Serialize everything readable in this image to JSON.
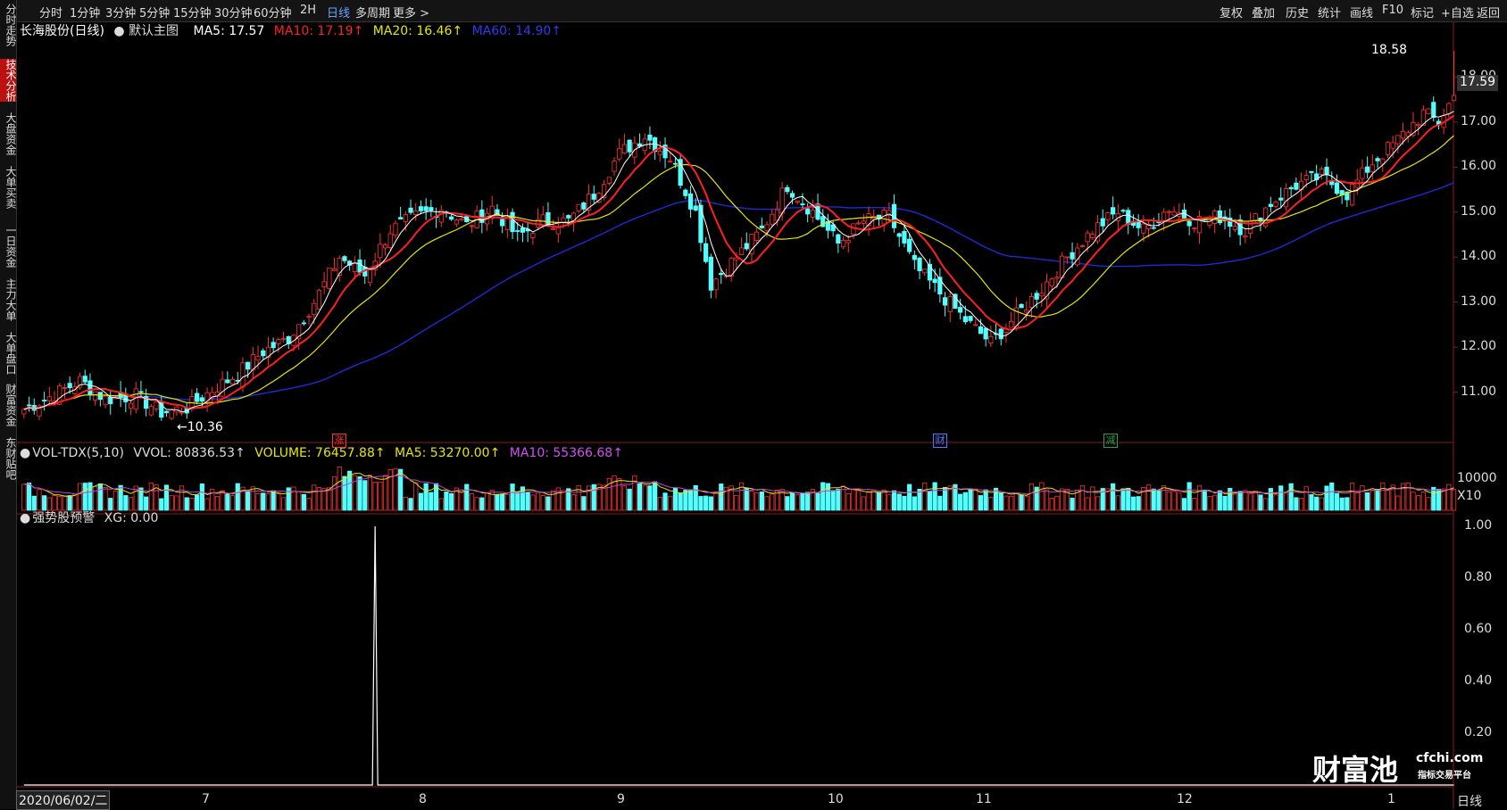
{
  "toolbar": {
    "periods": [
      "分时",
      "1分钟",
      "3分钟",
      "5分钟",
      "15分钟",
      "30分钟",
      "60分钟",
      "2H",
      "日线",
      "多周期",
      "更多"
    ],
    "active_period": "日线",
    "tools": [
      "复权",
      "叠加",
      "历史",
      "统计",
      "画线",
      "F10",
      "标记",
      "+自选",
      "返回"
    ]
  },
  "sidebar": {
    "tabs": [
      "分时走势",
      "技术分析",
      "大盘资金",
      "大单买卖",
      "一日资金",
      "主力大单",
      "大单盘口",
      "财富资金",
      "东财贴吧"
    ],
    "active": "技术分析"
  },
  "main_legend": {
    "stock": "长海股份(日线)",
    "template": "默认主图",
    "ma5": "MA5: 17.57",
    "ma10": "MA10: 17.19↑",
    "ma20": "MA20: 16.46↑",
    "ma60": "MA60: 14.90↑"
  },
  "vol_legend": {
    "name": "VOL-TDX(5,10)",
    "vvol": "VVOL: 80836.53↑",
    "volume": "VOLUME: 76457.88↑",
    "ma5": "MA5: 53270.00↑",
    "ma10": "MA10: 55366.68↑"
  },
  "ind_legend": {
    "name": "强势股预警",
    "xg": "XG: 0.00"
  },
  "colors": {
    "up": "#ff3232",
    "down": "#54ffff",
    "ma5": "#ffffff",
    "ma10": "#ff2020",
    "ma20": "#e6e600",
    "ma60": "#1a2cd6",
    "vol_ma5": "#e6e600",
    "vol_ma10": "#c040e0"
  },
  "price_axis": [
    "18.00",
    "17.00",
    "16.00",
    "15.00",
    "14.00",
    "13.00",
    "12.00",
    "11.00"
  ],
  "volume_axis": {
    "top": "10000",
    "unit": "X10"
  },
  "indicator_axis": [
    "1.00",
    "0.80",
    "0.60",
    "0.40",
    "0.20"
  ],
  "last_price": "17.59",
  "high_label": "18.58",
  "low_label": "10.36",
  "markers": [
    {
      "text": "涨",
      "color": "#ff3232"
    },
    {
      "text": "财",
      "color": "#4a7dff"
    },
    {
      "text": "减",
      "color": "#2ea043"
    }
  ],
  "x_axis": {
    "date_box": "2020/06/02/二",
    "months": [
      "7",
      "8",
      "9",
      "10",
      "11",
      "12",
      "1"
    ],
    "period_label": "日线"
  },
  "watermark": {
    "brand": "财富池",
    "site": "cfchi.com",
    "slogan": "指标交易平台"
  },
  "chart_data": {
    "type": "candlestick",
    "title": "长海股份(日线)",
    "price_ylim": [
      10.0,
      18.8
    ],
    "anchors": [
      [
        0,
        10.62
      ],
      [
        6,
        10.95
      ],
      [
        11,
        11.25
      ],
      [
        16,
        10.85
      ],
      [
        22,
        10.92
      ],
      [
        27,
        10.55
      ],
      [
        32,
        10.65
      ],
      [
        37,
        11.05
      ],
      [
        42,
        11.4
      ],
      [
        47,
        11.9
      ],
      [
        52,
        12.2
      ],
      [
        57,
        13.0
      ],
      [
        62,
        14.0
      ],
      [
        67,
        13.6
      ],
      [
        72,
        14.6
      ],
      [
        77,
        14.9
      ],
      [
        82,
        15.1
      ],
      [
        87,
        14.7
      ],
      [
        92,
        15.1
      ],
      [
        97,
        14.45
      ],
      [
        102,
        14.8
      ],
      [
        107,
        14.8
      ],
      [
        112,
        15.4
      ],
      [
        117,
        16.3
      ],
      [
        122,
        16.7
      ],
      [
        127,
        16.2
      ],
      [
        132,
        15.0
      ],
      [
        135,
        13.4
      ],
      [
        140,
        14.0
      ],
      [
        145,
        14.6
      ],
      [
        150,
        15.6
      ],
      [
        155,
        15.0
      ],
      [
        160,
        14.3
      ],
      [
        165,
        14.8
      ],
      [
        170,
        14.9
      ],
      [
        175,
        13.8
      ],
      [
        180,
        13.2
      ],
      [
        185,
        12.6
      ],
      [
        190,
        12.1
      ],
      [
        195,
        12.7
      ],
      [
        200,
        13.3
      ],
      [
        205,
        14.0
      ],
      [
        210,
        14.6
      ],
      [
        215,
        15.0
      ],
      [
        220,
        14.6
      ],
      [
        225,
        15.1
      ],
      [
        230,
        14.8
      ],
      [
        235,
        14.9
      ],
      [
        240,
        14.6
      ],
      [
        245,
        15.2
      ],
      [
        250,
        15.6
      ],
      [
        255,
        15.8
      ],
      [
        260,
        15.4
      ],
      [
        265,
        16.1
      ],
      [
        270,
        16.6
      ],
      [
        275,
        17.2
      ],
      [
        278,
        17.0
      ],
      [
        281,
        17.59
      ]
    ],
    "high": 18.58,
    "low": 10.36,
    "last_close": 17.59,
    "indicator_spike": {
      "index": 69,
      "value": 1.0
    },
    "x_months": [
      "7",
      "8",
      "9",
      "10",
      "11",
      "12",
      "1"
    ]
  }
}
